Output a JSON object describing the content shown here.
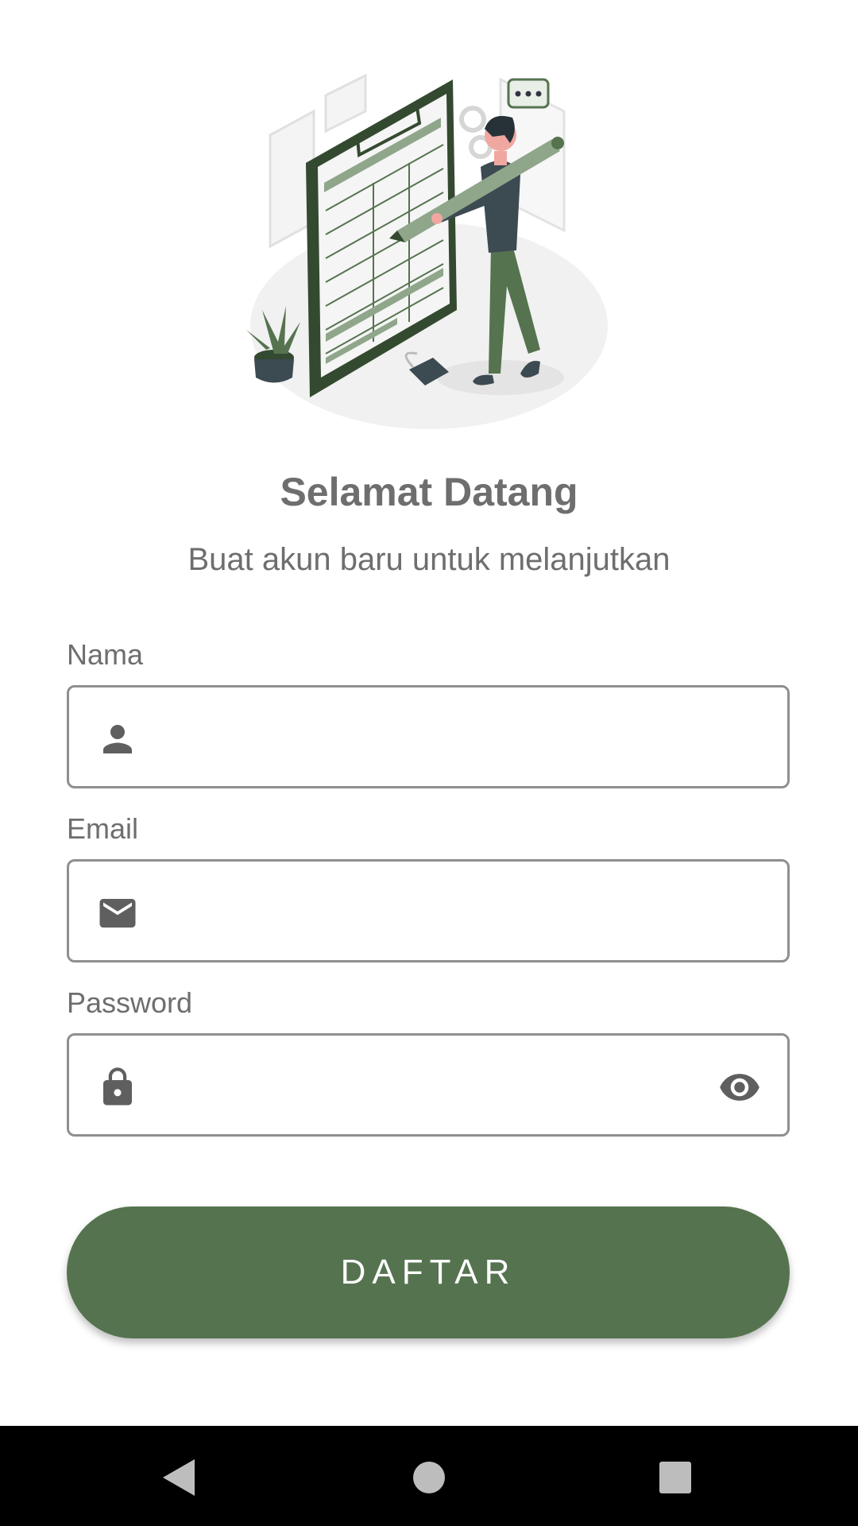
{
  "header": {
    "title": "Selamat Datang",
    "subtitle": "Buat akun baru untuk melanjutkan"
  },
  "form": {
    "name": {
      "label": "Nama",
      "value": "",
      "icon": "person-icon"
    },
    "email": {
      "label": "Email",
      "value": "",
      "icon": "mail-icon"
    },
    "password": {
      "label": "Password",
      "value": "",
      "icon": "lock-icon",
      "toggle_icon": "eye-icon"
    }
  },
  "submit": {
    "label": "DAFTAR"
  },
  "navigation": {
    "back_icon": "back-triangle-icon",
    "home_icon": "home-circle-icon",
    "recents_icon": "recents-square-icon"
  },
  "colors": {
    "accent": "#55734f",
    "text": "#6e6e6e",
    "border": "#8f8f8f"
  }
}
